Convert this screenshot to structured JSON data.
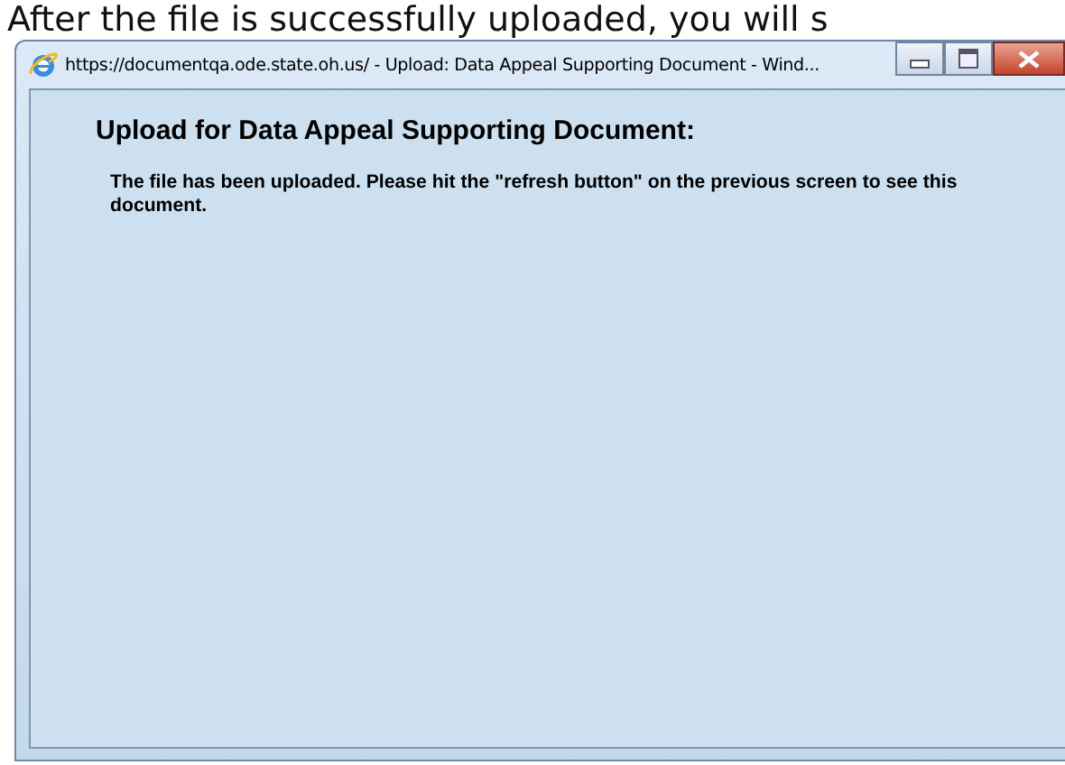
{
  "background_text": "After the file is successfully uploaded, you will s",
  "window": {
    "title": "https://documentqa.ode.state.oh.us/ - Upload: Data Appeal Supporting Document - Wind...",
    "heading": "Upload for Data Appeal Supporting Document:",
    "message": "The file has been uploaded. Please hit the \"refresh button\" on the previous screen to see this document."
  }
}
